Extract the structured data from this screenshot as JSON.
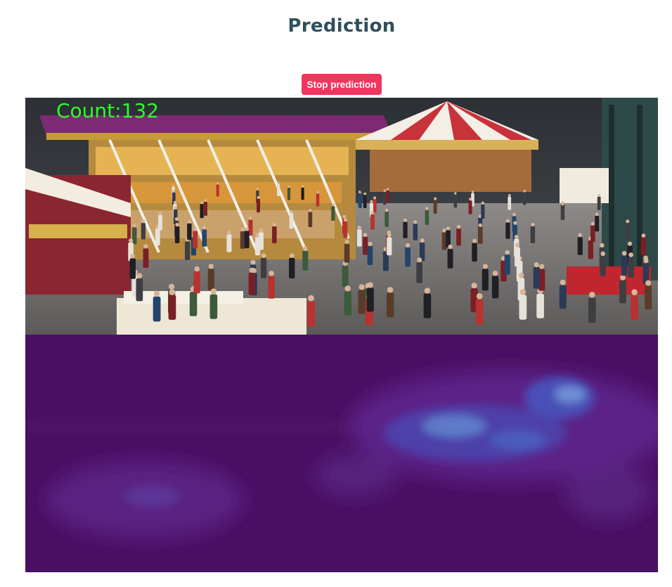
{
  "page": {
    "title": "Prediction"
  },
  "controls": {
    "stop_label": "Stop prediction"
  },
  "video": {
    "count_label": "Count:132"
  },
  "colors": {
    "title": "#2f4f5c",
    "button": "#f0355e",
    "count_overlay": "#2bff2b",
    "heatmap_base": "#4a0f63"
  }
}
